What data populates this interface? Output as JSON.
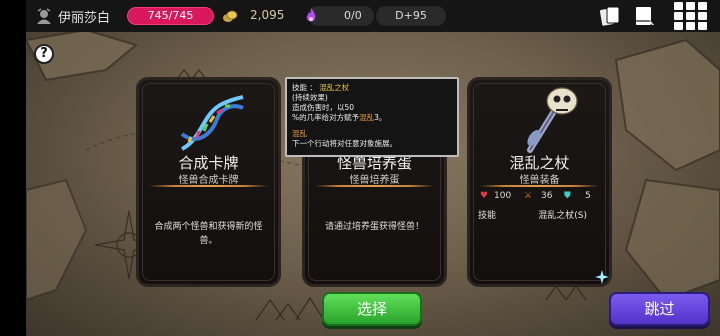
{
  "topbar": {
    "player_name": "伊丽莎白",
    "hp": "745/745",
    "gold": "2,095",
    "souls": "0/0",
    "day": "D+95",
    "icons": [
      "avatar-icon",
      "coin-icon",
      "soul-flame-icon",
      "cards-icon",
      "book-icon",
      "grid-menu-icon"
    ]
  },
  "help": {
    "label": "?"
  },
  "cards": [
    {
      "title": "合成卡牌",
      "subtitle": "怪兽合成卡牌",
      "description": "合成两个怪兽和获得新的怪兽。",
      "art": "dna-helix-icon"
    },
    {
      "title": "怪兽培养蛋",
      "subtitle": "怪兽培养蛋",
      "description": "请通过培养蛋获得怪兽！",
      "art": "egg-nest-icon"
    },
    {
      "title": "混乱之杖",
      "subtitle": "怪兽装备",
      "stats": {
        "hp": "100",
        "attack": "36",
        "defense": "5"
      },
      "skill_label": "技能",
      "skill_value": "混乱之杖(S)",
      "art": "skull-staff-icon"
    }
  ],
  "tooltip": {
    "line1_prefix": "技能 ：",
    "line1_name": "混乱之杖",
    "line2": "(持续效果)",
    "line3": "造成伤害时，以50",
    "line4_a": "%的几率给对方赋予",
    "line4_b": "混乱",
    "line4_c": "3。",
    "line5": "混乱",
    "line6": "下一个行动将对任意对象施展。"
  },
  "buttons": {
    "select": "选择",
    "skip": "跳过"
  },
  "colors": {
    "hp_bar": "#d8185a",
    "select_button": "#2aa32a",
    "skip_button": "#5334c9",
    "divider": "#e0a050"
  }
}
